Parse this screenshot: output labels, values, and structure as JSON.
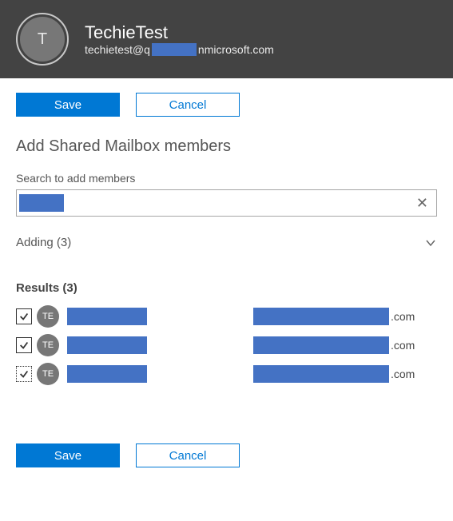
{
  "header": {
    "avatar_initial": "T",
    "title": "TechieTest",
    "email_prefix": "techietest@q",
    "email_suffix": "nmicrosoft.com"
  },
  "buttons": {
    "save": "Save",
    "cancel": "Cancel"
  },
  "section": {
    "title": "Add Shared Mailbox members",
    "search_label": "Search to add members"
  },
  "search": {
    "value": "",
    "placeholder": ""
  },
  "adding": {
    "label": "Adding (3)"
  },
  "results": {
    "label": "Results (3)",
    "rows": [
      {
        "initials": "TE",
        "email_suffix": ".com",
        "checked": true,
        "dotted": false
      },
      {
        "initials": "TE",
        "email_suffix": ".com",
        "checked": true,
        "dotted": false
      },
      {
        "initials": "TE",
        "email_suffix": ".com",
        "checked": true,
        "dotted": true
      }
    ]
  }
}
